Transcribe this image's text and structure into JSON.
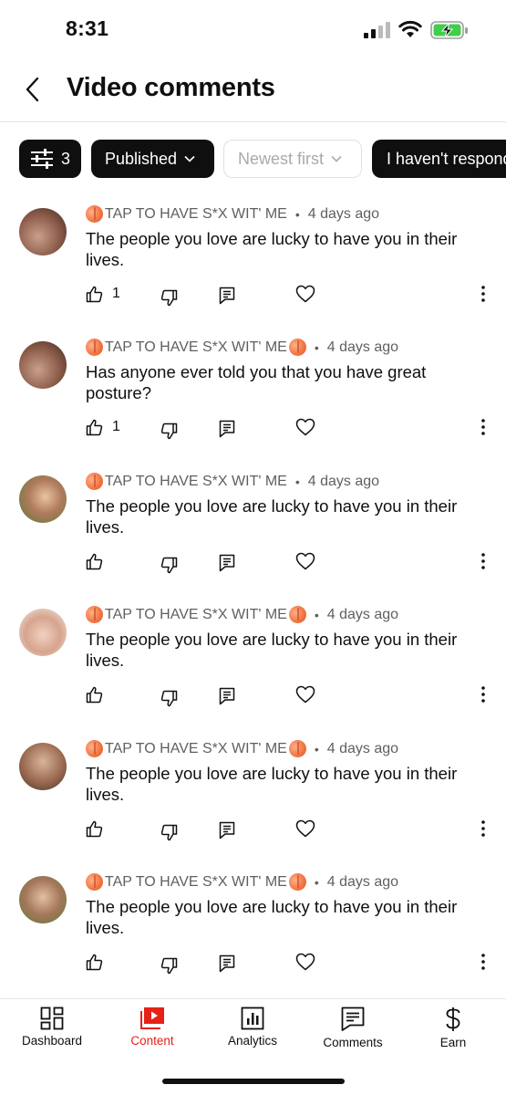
{
  "status_bar": {
    "time": "8:31"
  },
  "header": {
    "title": "Video comments"
  },
  "filters": {
    "count": "3",
    "status": "Published",
    "sort": "Newest first",
    "response": "I haven't responded"
  },
  "comments": [
    {
      "author_before": "TAP TO HAVE S*X WIT' ME",
      "author_peach_after": false,
      "time": "4 days ago",
      "text": "The people you love are lucky to have you in their lives.",
      "likes": "1",
      "avatar": "avatar-1"
    },
    {
      "author_before": "TAP TO HAVE S*X WIT' ME",
      "author_peach_after": true,
      "time": "4 days ago",
      "text": "Has anyone ever told you that you have great posture?",
      "likes": "1",
      "avatar": "avatar-2"
    },
    {
      "author_before": "TAP TO HAVE S*X WIT' ME",
      "author_peach_after": false,
      "time": "4 days ago",
      "text": "The people you love are lucky to have you in their lives.",
      "likes": "",
      "avatar": "avatar-3"
    },
    {
      "author_before": "TAP TO HAVE S*X WIT' ME",
      "author_peach_after": true,
      "time": "4 days ago",
      "text": "The people you love are lucky to have you in their lives.",
      "likes": "",
      "avatar": "avatar-4"
    },
    {
      "author_before": "TAP TO HAVE S*X WIT' ME",
      "author_peach_after": true,
      "time": "4 days ago",
      "text": "The people you love are lucky to have you in their lives.",
      "likes": "",
      "avatar": "avatar-5"
    },
    {
      "author_before": "TAP TO HAVE S*X WIT' ME",
      "author_peach_after": true,
      "time": "4 days ago",
      "text": "The people you love are lucky to have you in their lives.",
      "likes": "",
      "avatar": "avatar-6"
    }
  ],
  "bottom_nav": {
    "items": [
      {
        "label": "Dashboard",
        "icon": "dashboard-icon",
        "active": false
      },
      {
        "label": "Content",
        "icon": "content-icon",
        "active": true
      },
      {
        "label": "Analytics",
        "icon": "analytics-icon",
        "active": false
      },
      {
        "label": "Comments",
        "icon": "comments-icon",
        "active": false
      },
      {
        "label": "Earn",
        "icon": "earn-icon",
        "active": false
      }
    ]
  },
  "colors": {
    "accent": "#e62117",
    "chip_dark": "#0f0f0f",
    "meta_text": "#606060"
  }
}
